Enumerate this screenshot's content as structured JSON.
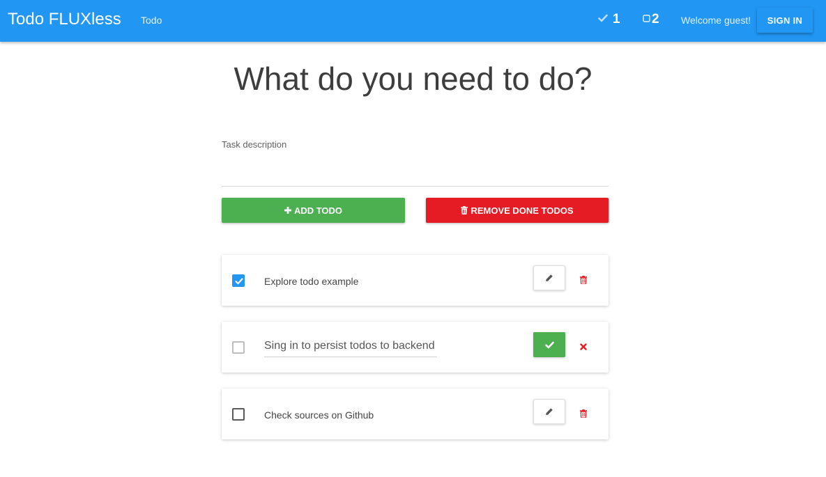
{
  "header": {
    "brand": "Todo FLUXless",
    "nav_link": "Todo",
    "done_count": "1",
    "open_count": "2",
    "welcome": "Welcome guest!",
    "signin_label": "SIGN IN"
  },
  "main": {
    "title": "What do you need to do?",
    "input_label": "Task description",
    "input_value": "",
    "add_label": "ADD TODO",
    "remove_label": "REMOVE DONE TODOS"
  },
  "todos": [
    {
      "text": "Explore todo example",
      "done": true,
      "editing": false
    },
    {
      "text": "Sing in to persist todos to backend",
      "done": false,
      "editing": true
    },
    {
      "text": "Check sources on Github",
      "done": false,
      "editing": false
    }
  ],
  "colors": {
    "navbar": "#2196f3",
    "add_button": "#4caf50",
    "remove_button": "#e51c23",
    "checkbox_checked": "#2196f3",
    "delete_icon": "#e51c23"
  },
  "icons": {
    "done_stat": "check-icon",
    "open_stat": "square-icon",
    "add": "plus-icon",
    "remove": "trash-icon",
    "edit": "pencil-icon",
    "delete": "trash-icon",
    "save": "check-icon",
    "cancel": "close-icon"
  }
}
